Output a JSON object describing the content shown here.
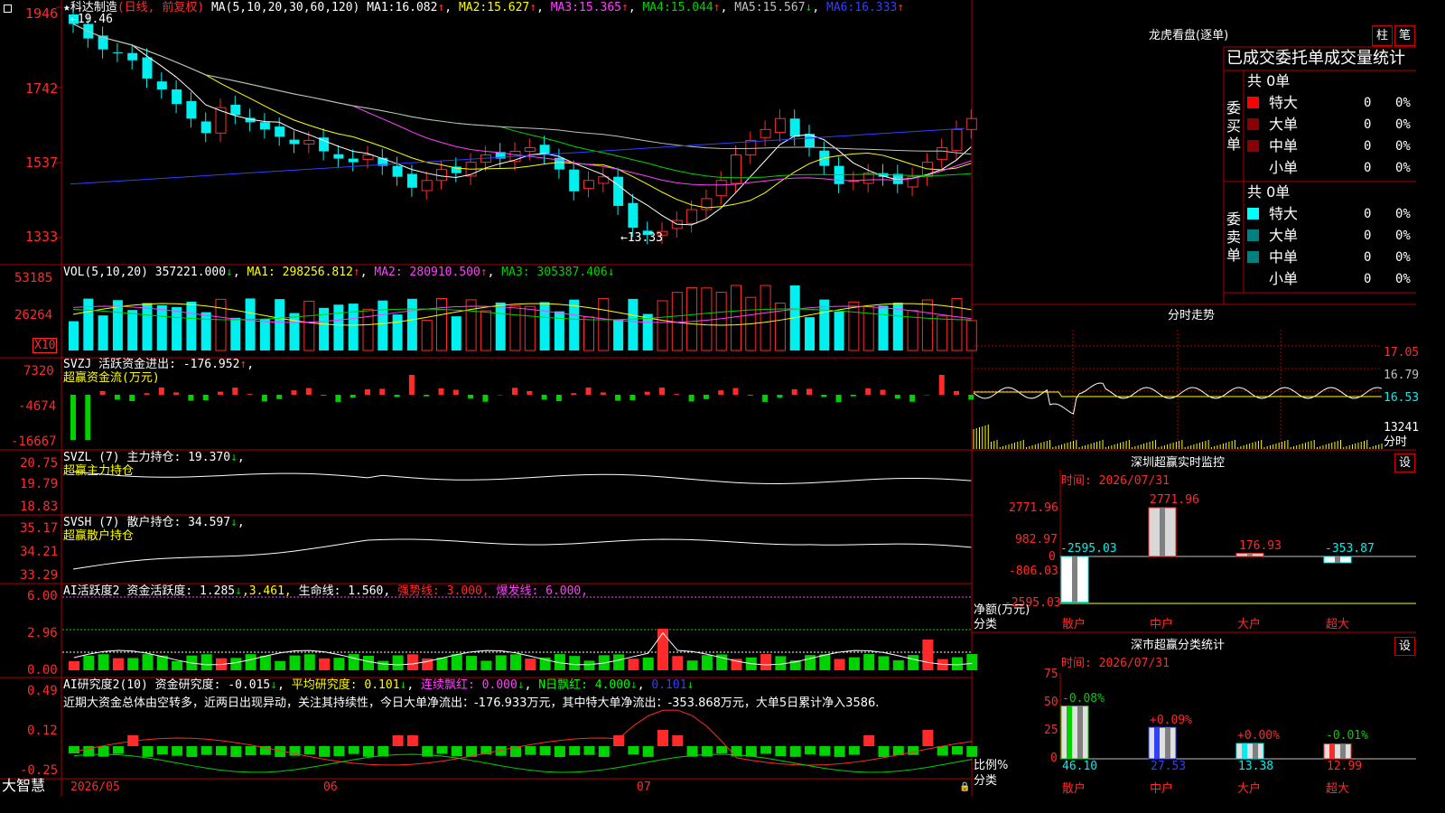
{
  "colors": {
    "up": "#ff2a2a",
    "down": "#00f0f0",
    "green": "#00d200",
    "frame": "#b00000",
    "text": "#ffffff",
    "yellow": "#ffff00",
    "magenta": "#ff40ff",
    "blue": "#3040ff",
    "gray": "#c0c0c0"
  },
  "main": {
    "title": "科达制造",
    "star": "★",
    "period": "(日线, 前复权)",
    "ma_params": "MA(5,10,20,30,60,120)",
    "ma": [
      {
        "name": "MA1:",
        "val": "16.082",
        "arrow": "↑"
      },
      {
        "name": "MA2:",
        "val": "15.627",
        "arrow": "↑"
      },
      {
        "name": "MA3:",
        "val": "15.365",
        "arrow": "↑"
      },
      {
        "name": "MA4:",
        "val": "15.044",
        "arrow": "↑"
      },
      {
        "name": "MA5:",
        "val": "15.567",
        "arrow": "↓"
      },
      {
        "name": "MA6:",
        "val": "16.333",
        "arrow": "↑"
      }
    ],
    "yaxis": [
      "1946",
      "1742",
      "1537",
      "1333"
    ],
    "high_label": "←19.46",
    "low_label": "←13.33"
  },
  "vol": {
    "params": "VOL(5,10,20)",
    "value": "357221.000",
    "v_arrow": "↓",
    "ma1": "MA1: 298256.812",
    "ma1_arrow": "↑",
    "ma2": "MA2: 280910.500",
    "ma2_arrow": "↑",
    "ma3": "MA3: 305387.406",
    "ma3_arrow": "↓",
    "yaxis": [
      "53185",
      "26264"
    ],
    "unit": "X10"
  },
  "svzj": {
    "label": "SVZJ  活跃资金进出: -176.952",
    "arrow": "↑",
    "sub": "超赢资金流(万元)",
    "yaxis": [
      "7320",
      "-4674",
      "-16667"
    ]
  },
  "svzl": {
    "label": "SVZL (7) 主力持仓: 19.370",
    "arrow": "↓",
    "sub": "超赢主力持仓",
    "yaxis": [
      "20.75",
      "19.79",
      "18.83"
    ]
  },
  "svsh": {
    "label": "SVSH (7) 散户持仓: 34.597",
    "arrow": "↓",
    "sub": "超赢散户持仓",
    "yaxis": [
      "35.17",
      "34.21",
      "33.29"
    ]
  },
  "ai1": {
    "name": "AI活跃度2",
    "l1": "资金活跃度: 1.285",
    "a1": "↓",
    "l2": "3.461,",
    "l3": "生命线: 1.560,",
    "l4": "强势线: 3.000,",
    "l5": "爆发线: 6.000,",
    "yaxis": [
      "6.00",
      "2.96",
      "0.00"
    ]
  },
  "ai2": {
    "name": "AI研究度2(10)",
    "l1": "资金研究度: -0.015",
    "a1": "↓",
    "l2": "平均研究度: 0.101",
    "a2": "↓",
    "l3": "连续飘红: 0.000",
    "a3": "↓",
    "l4": "N日飘红: 4.000",
    "a4": "↓",
    "l5": "0.101",
    "a5": "↓",
    "text": "近期大资金总体由空转多，近两日出现异动，关注其持续性，今日大单净流出：-176.933万元，其中特大单净流出：-353.868万元，大单5日累计净入3586.",
    "yaxis": [
      "0.49",
      "0.12",
      "-0.25"
    ]
  },
  "xaxis": {
    "brand": "大智慧",
    "labels": [
      "2026/05",
      "06",
      "07"
    ]
  },
  "lhb": {
    "title": "龙虎看盘(逐单)",
    "btn1": "柱",
    "btn2": "笔",
    "tabs": "已成交委托单成交量统计",
    "buy": {
      "side": "委买单",
      "total": "共 0单",
      "rows": [
        {
          "name": "特大",
          "v": "0",
          "p": "0%"
        },
        {
          "name": "大单",
          "v": "0",
          "p": "0%"
        },
        {
          "name": "中单",
          "v": "0",
          "p": "0%"
        },
        {
          "name": "小单",
          "v": "0",
          "p": "0%"
        }
      ]
    },
    "sell": {
      "side": "委卖单",
      "total": "共 0单",
      "rows": [
        {
          "name": "特大",
          "v": "0",
          "p": "0%"
        },
        {
          "name": "大单",
          "v": "0",
          "p": "0%"
        },
        {
          "name": "中单",
          "v": "0",
          "p": "0%"
        },
        {
          "name": "小单",
          "v": "0",
          "p": "0%"
        }
      ]
    }
  },
  "fenshi": {
    "title": "分时走势",
    "prices": [
      "17.05",
      "16.79",
      "16.53"
    ],
    "vol": "13241",
    "unit": "分时"
  },
  "monitor": {
    "title": "深圳超赢实时监控",
    "set": "设",
    "time": "时间: 2026/07/31",
    "yaxis": [
      "2771.96",
      "982.97",
      "0",
      "-806.03",
      "-2595.03"
    ],
    "ylabel": "净额(万元)",
    "xlabel": "分类",
    "cats": [
      "散户",
      "中户",
      "大户",
      "超大"
    ],
    "values": [
      "-2595.03",
      "2771.96",
      "176.93",
      "-353.87"
    ]
  },
  "stats": {
    "title": "深市超赢分类统计",
    "set": "设",
    "time": "时间: 2026/07/31",
    "yaxis": [
      "75",
      "50",
      "25",
      "0"
    ],
    "ylabel": "比例%",
    "xlabel": "分类",
    "cats": [
      "散户",
      "中户",
      "大户",
      "超大"
    ],
    "pct": [
      "46.10",
      "27.53",
      "13.38",
      "12.99"
    ],
    "chg": [
      "-0.08%",
      "+0.09%",
      "+0.00%",
      "-0.01%"
    ]
  }
}
